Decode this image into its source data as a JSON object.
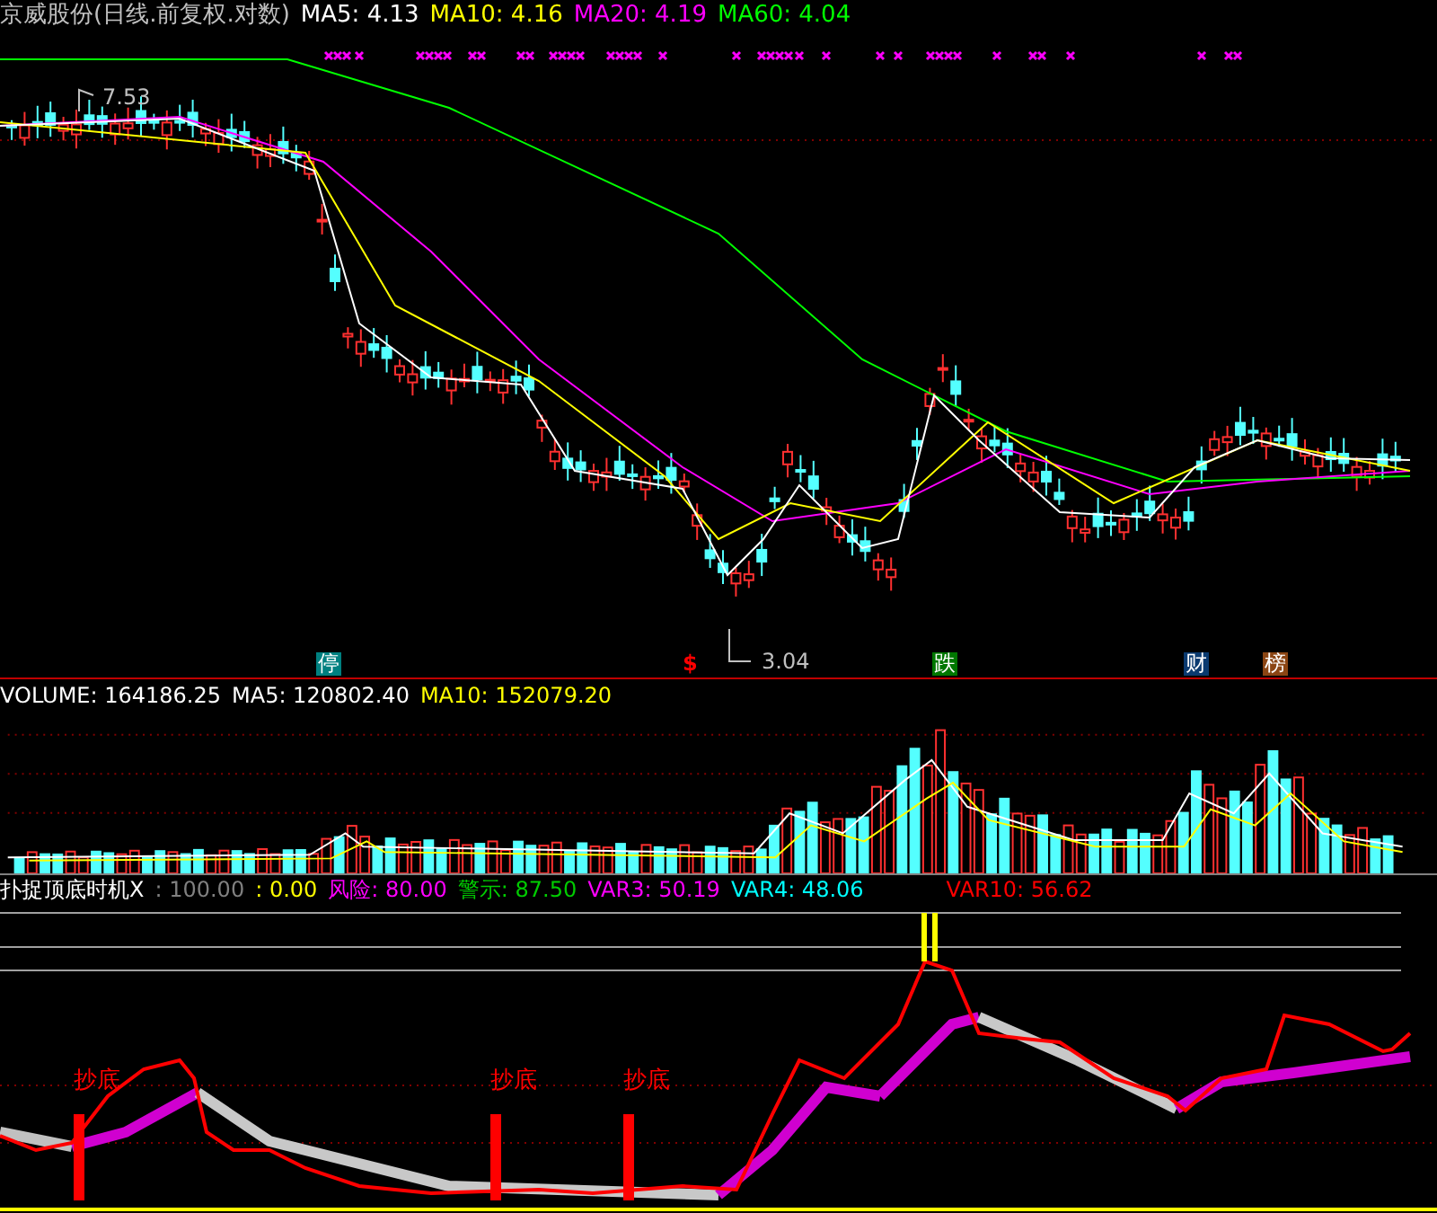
{
  "price_panel": {
    "title": "京威股份(日线.前复权.对数)",
    "legend": [
      {
        "label": "MA5: 4.13",
        "color": "#ffffff"
      },
      {
        "label": "MA10: 4.16",
        "color": "#ffff00"
      },
      {
        "label": "MA20: 4.19",
        "color": "#ff00ff"
      },
      {
        "label": "MA60: 4.04",
        "color": "#00ff00"
      }
    ],
    "high_label": "7.53",
    "low_label": "3.04",
    "badges": [
      {
        "text": "停",
        "kind": "badge",
        "color": "#008080"
      },
      {
        "text": "$",
        "kind": "glyph",
        "color": "#ff0000"
      },
      {
        "text": "跌",
        "kind": "badge",
        "color": "#007700"
      },
      {
        "text": "财",
        "kind": "badge",
        "color": "#0a3a70"
      },
      {
        "text": "榜",
        "kind": "badge",
        "color": "#8b4513"
      }
    ]
  },
  "volume_panel": {
    "legend": [
      {
        "label": "VOLUME: 164186.25",
        "color": "#ffffff"
      },
      {
        "label": "MA5: 120802.40",
        "color": "#ffffff"
      },
      {
        "label": "MA10: 152079.20",
        "color": "#ffff00"
      }
    ]
  },
  "indicator_panel": {
    "legend": [
      {
        "label": "扑捉顶底时机X",
        "color": "#ffffff"
      },
      {
        "label": ": 100.00",
        "color": "#808080"
      },
      {
        "label": ": 0.00",
        "color": "#ffff00"
      },
      {
        "label": "风险: 80.00",
        "color": "#ff00ff"
      },
      {
        "label": "警示: 87.50",
        "color": "#00cc00"
      },
      {
        "label": "VAR3: 50.19",
        "color": "#ff00ff"
      },
      {
        "label": "VAR4: 48.06",
        "color": "#00ffff"
      },
      {
        "label": "VAR10: 56.62",
        "color": "#ff0000"
      }
    ],
    "signals": [
      "抄底",
      "抄底",
      "抄底"
    ]
  }
}
